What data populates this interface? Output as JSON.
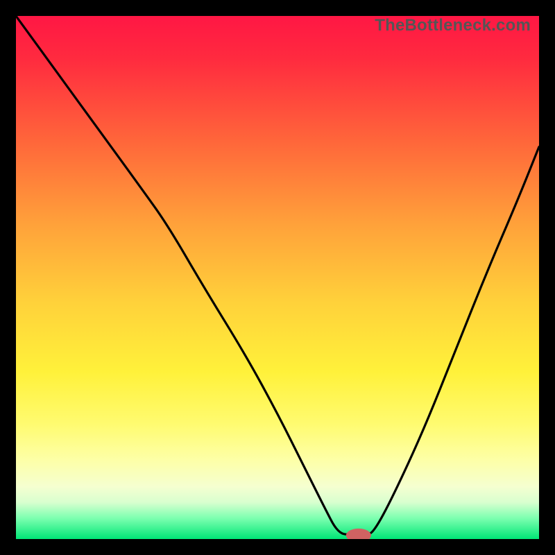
{
  "watermark": "TheBottleneck.com",
  "chart_data": {
    "type": "line",
    "title": "",
    "xlabel": "",
    "ylabel": "",
    "xlim": [
      0,
      100
    ],
    "ylim": [
      0,
      100
    ],
    "gradient_stops": [
      {
        "offset": 0.0,
        "color": "#ff1744"
      },
      {
        "offset": 0.08,
        "color": "#ff2a3f"
      },
      {
        "offset": 0.25,
        "color": "#ff6a3a"
      },
      {
        "offset": 0.4,
        "color": "#ffa23a"
      },
      {
        "offset": 0.55,
        "color": "#ffd23a"
      },
      {
        "offset": 0.68,
        "color": "#fff13a"
      },
      {
        "offset": 0.78,
        "color": "#fffb70"
      },
      {
        "offset": 0.85,
        "color": "#fdffa8"
      },
      {
        "offset": 0.9,
        "color": "#f5ffd0"
      },
      {
        "offset": 0.93,
        "color": "#d8ffcf"
      },
      {
        "offset": 0.96,
        "color": "#7dffb0"
      },
      {
        "offset": 1.0,
        "color": "#00e676"
      }
    ],
    "series": [
      {
        "name": "bottleneck-curve",
        "x": [
          0,
          8,
          16,
          24,
          29,
          36,
          44,
          50,
          55,
          59,
          61.5,
          64,
          67,
          68.5,
          72,
          78,
          84,
          90,
          96,
          100
        ],
        "y": [
          100,
          89,
          78,
          67,
          60,
          48,
          35,
          24,
          14,
          6,
          1.2,
          0.7,
          0.7,
          1.5,
          8,
          21,
          36,
          51,
          65,
          75
        ]
      }
    ],
    "marker": {
      "x": 65.5,
      "y": 0.7,
      "rx": 2.4,
      "ry": 1.3,
      "color": "#d06262"
    }
  }
}
